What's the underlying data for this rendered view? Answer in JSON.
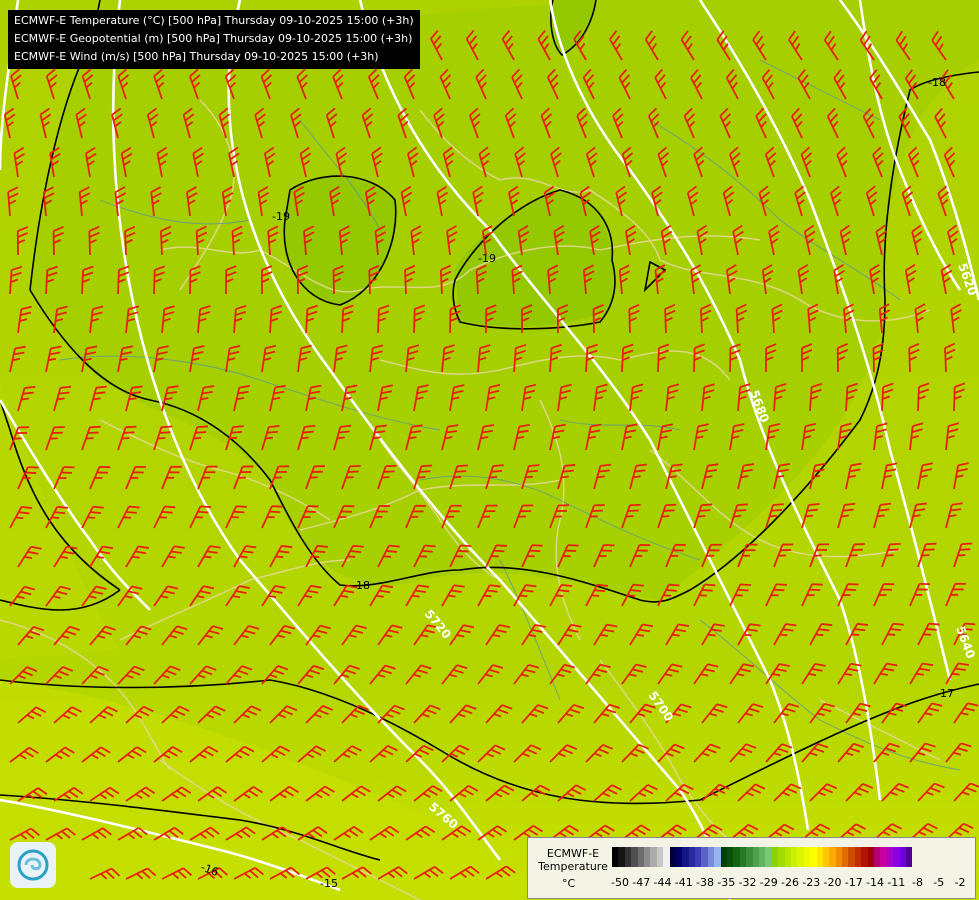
{
  "titles": {
    "line1": "ECMWF-E Temperature (°C) [500 hPa] Thursday 09-10-2025 15:00 (+3h)",
    "line2": "ECMWF-E Geopotential (m) [500 hPa] Thursday 09-10-2025 15:00 (+3h)",
    "line3": "ECMWF-E Wind (m/s) [500 hPa] Thursday 09-10-2025 15:00 (+3h)"
  },
  "map_labels": {
    "t_m19_a": "-19",
    "t_m19_b": "-19",
    "t_m18_ne": "-18",
    "t_m18_s": "-18",
    "t_m17": "-17",
    "t_m16": "-16",
    "t_m15": "-15",
    "gp_5620": "5620",
    "gp_5640": "5640",
    "gp_5680": "5680",
    "gp_5700": "5700",
    "gp_5720": "5720",
    "gp_5760": "5760"
  },
  "legend": {
    "title": "ECMWF-E Temperature",
    "unit": "°C",
    "ticks": [
      "-50",
      "-47",
      "-44",
      "-41",
      "-38",
      "-35",
      "-32",
      "-29",
      "-26",
      "-23",
      "-20",
      "-17",
      "-14",
      "-11",
      "-8",
      "-5",
      "-2"
    ],
    "colors": [
      "#000000",
      "#141414",
      "#323232",
      "#505050",
      "#6e6e6e",
      "#8c8c8c",
      "#aaaaaa",
      "#c8c8c8",
      "#f0f0f0",
      "#000040",
      "#000066",
      "#141485",
      "#2828a0",
      "#3c3cb4",
      "#5a64c8",
      "#788cdc",
      "#96b4f0",
      "#004000",
      "#0a500a",
      "#146414",
      "#287828",
      "#3c8c3c",
      "#50a050",
      "#64b464",
      "#78c878",
      "#8cd200",
      "#a0dc00",
      "#b4e600",
      "#c8f000",
      "#dcf500",
      "#f0fa00",
      "#ffff00",
      "#ffe600",
      "#ffc800",
      "#ffaa00",
      "#f08c00",
      "#e06c00",
      "#d04c00",
      "#c03000",
      "#b41400",
      "#a00000",
      "#b4006e",
      "#c800a0",
      "#aa00c8",
      "#8c00e6",
      "#6e00dc",
      "#50008c"
    ]
  },
  "icons": {
    "logo": "ecmwf-logo-icon"
  }
}
